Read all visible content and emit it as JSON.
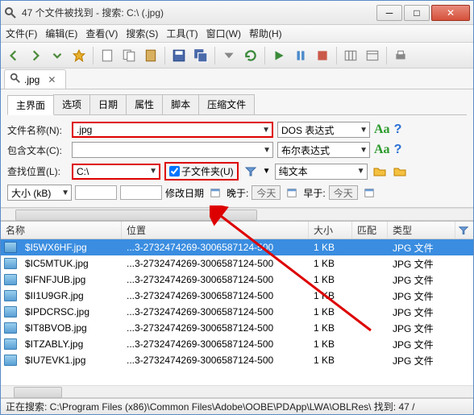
{
  "window": {
    "title": "47 个文件被找到 - 搜索: C:\\ (.jpg)"
  },
  "menu": {
    "file": "文件(F)",
    "edit": "编辑(E)",
    "view": "查看(V)",
    "search": "搜索(S)",
    "tools": "工具(T)",
    "window": "窗口(W)",
    "help": "帮助(H)"
  },
  "tab": {
    "label": ".jpg"
  },
  "subtabs": {
    "main": "主界面",
    "options": "选项",
    "date": "日期",
    "attr": "属性",
    "script": "脚本",
    "zip": "压缩文件"
  },
  "labels": {
    "filename": "文件名称(N):",
    "contains": "包含文本(C):",
    "lookin": "查找位置(L):",
    "subfolders": "子文件夹(U)",
    "size": "大小 (kB)",
    "moddate": "修改日期",
    "later": "晚于:",
    "earlier": "早于:",
    "today1": "今天",
    "today2": "今天"
  },
  "fields": {
    "filename": ".jpg",
    "lookin": "C:\\"
  },
  "modes": {
    "dos": "DOS 表达式",
    "bool": "布尔表达式",
    "plain": "纯文本"
  },
  "columns": {
    "name": "名称",
    "loc": "位置",
    "size": "大小",
    "match": "匹配",
    "type": "类型"
  },
  "results": [
    {
      "name": "$I5WX6HF.jpg",
      "loc": "...3-2732474269-3006587124-500",
      "size": "1 KB",
      "type": "JPG 文件"
    },
    {
      "name": "$IC5MTUK.jpg",
      "loc": "...3-2732474269-3006587124-500",
      "size": "1 KB",
      "type": "JPG 文件"
    },
    {
      "name": "$IFNFJUB.jpg",
      "loc": "...3-2732474269-3006587124-500",
      "size": "1 KB",
      "type": "JPG 文件"
    },
    {
      "name": "$II1U9GR.jpg",
      "loc": "...3-2732474269-3006587124-500",
      "size": "1 KB",
      "type": "JPG 文件"
    },
    {
      "name": "$IPDCRSC.jpg",
      "loc": "...3-2732474269-3006587124-500",
      "size": "1 KB",
      "type": "JPG 文件"
    },
    {
      "name": "$IT8BVOB.jpg",
      "loc": "...3-2732474269-3006587124-500",
      "size": "1 KB",
      "type": "JPG 文件"
    },
    {
      "name": "$ITZABLY.jpg",
      "loc": "...3-2732474269-3006587124-500",
      "size": "1 KB",
      "type": "JPG 文件"
    },
    {
      "name": "$IU7EVK1.jpg",
      "loc": "...3-2732474269-3006587124-500",
      "size": "1 KB",
      "type": "JPG 文件"
    }
  ],
  "status": "正在搜索: C:\\Program Files (x86)\\Common Files\\Adobe\\OOBE\\PDApp\\LWA\\OBLRes\\ 找到: 47 / ",
  "colors": {
    "accent": "#3a8de0",
    "red": "#d00",
    "green": "#2a9a2a"
  }
}
